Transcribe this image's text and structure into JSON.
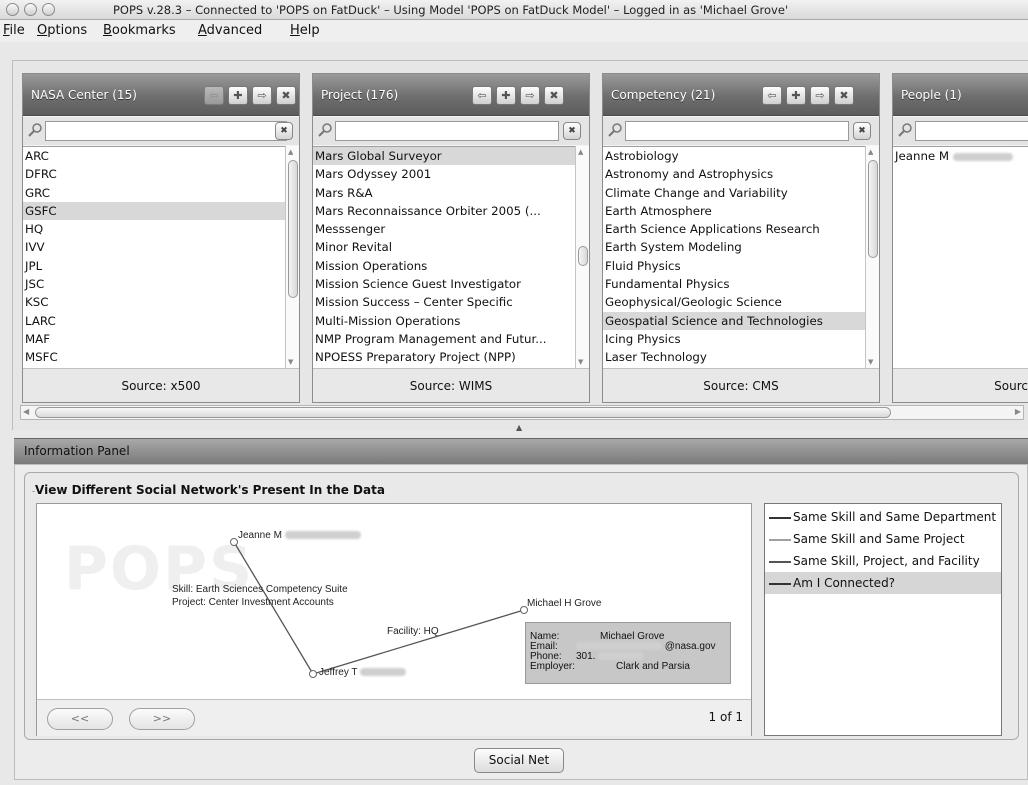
{
  "window": {
    "title": "POPS v.28.3 – Connected to 'POPS on FatDuck' – Using Model 'POPS on FatDuck Model' – Logged in as 'Michael Grove'"
  },
  "menu": [
    {
      "label": "File",
      "mnemonic": "F",
      "rest": "ile"
    },
    {
      "label": "Options",
      "mnemonic": "O",
      "rest": "ptions"
    },
    {
      "label": "Bookmarks",
      "mnemonic": "B",
      "rest": "ookmarks"
    },
    {
      "label": "Advanced",
      "mnemonic": "A",
      "rest": "dvanced"
    },
    {
      "label": "Help",
      "mnemonic": "H",
      "rest": "elp"
    }
  ],
  "panes": [
    {
      "title": "NASA Center (15)",
      "search_value": "",
      "items": [
        "ARC",
        "DFRC",
        "GRC",
        "GSFC",
        "HQ",
        "IVV",
        "JPL",
        "JSC",
        "KSC",
        "LARC",
        "MAF",
        "MSFC"
      ],
      "selected_index": 3,
      "source": "Source: x500"
    },
    {
      "title": "Project (176)",
      "search_value": "",
      "items": [
        "Mars Global Surveyor",
        "Mars Odyssey 2001",
        "Mars R&A",
        "Mars Reconnaissance Orbiter 2005 (...",
        "Messsenger",
        "Minor Revital",
        "Mission Operations",
        "Mission Science Guest Investigator",
        "Mission Success – Center Specific",
        "Multi-Mission Operations",
        "NMP Program Management and Futur...",
        "NPOESS Preparatory Project (NPP)"
      ],
      "selected_index": 0,
      "source": "Source: WIMS"
    },
    {
      "title": "Competency (21)",
      "search_value": "",
      "items": [
        "Astrobiology",
        "Astronomy and Astrophysics",
        "Climate Change and Variability",
        "Earth Atmosphere",
        "Earth Science Applications Research",
        "Earth System Modeling",
        "Fluid Physics",
        "Fundamental Physics",
        "Geophysical/Geologic Science",
        "Geospatial Science and Technologies",
        "Icing Physics",
        "Laser Technology"
      ],
      "selected_index": 9,
      "source": "Source: CMS"
    },
    {
      "title": "People (1)",
      "search_value": "",
      "items": [
        "Jeanne M"
      ],
      "selected_index": -1,
      "source": "Sourc"
    }
  ],
  "info_panel": {
    "header": "Information Panel",
    "group_title": "View Different Social Network's Present In the Data",
    "watermark": "POPS",
    "nodes": {
      "jeanne": "Jeanne M",
      "jeffrey": "Jeffrey T",
      "michael": "Michael H Grove"
    },
    "edge_labels": {
      "skill": "Skill: Earth Sciences Competency Suite",
      "project": "Project: Center Investment Accounts",
      "facility": "Facility: HQ"
    },
    "detail": {
      "name_key": "Name:",
      "name_val": "Michael Grove",
      "email_key": "Email:",
      "email_val": "@nasa.gov",
      "phone_key": "Phone:",
      "phone_val": "301.",
      "employer_key": "Employer:",
      "employer_val": "Clark and Parsia"
    },
    "prev_label": "<<",
    "next_label": ">>",
    "page": "1 of 1",
    "legend": [
      {
        "label": "Same Skill and Same Department",
        "color": "#333333"
      },
      {
        "label": "Same Skill and Same Project",
        "color": "#a0a0a0"
      },
      {
        "label": "Same Skill, Project, and Facility",
        "color": "#555555"
      },
      {
        "label": "Am I Connected?",
        "color": "#333333"
      }
    ],
    "legend_selected": 3,
    "action_button": "Social Net"
  }
}
